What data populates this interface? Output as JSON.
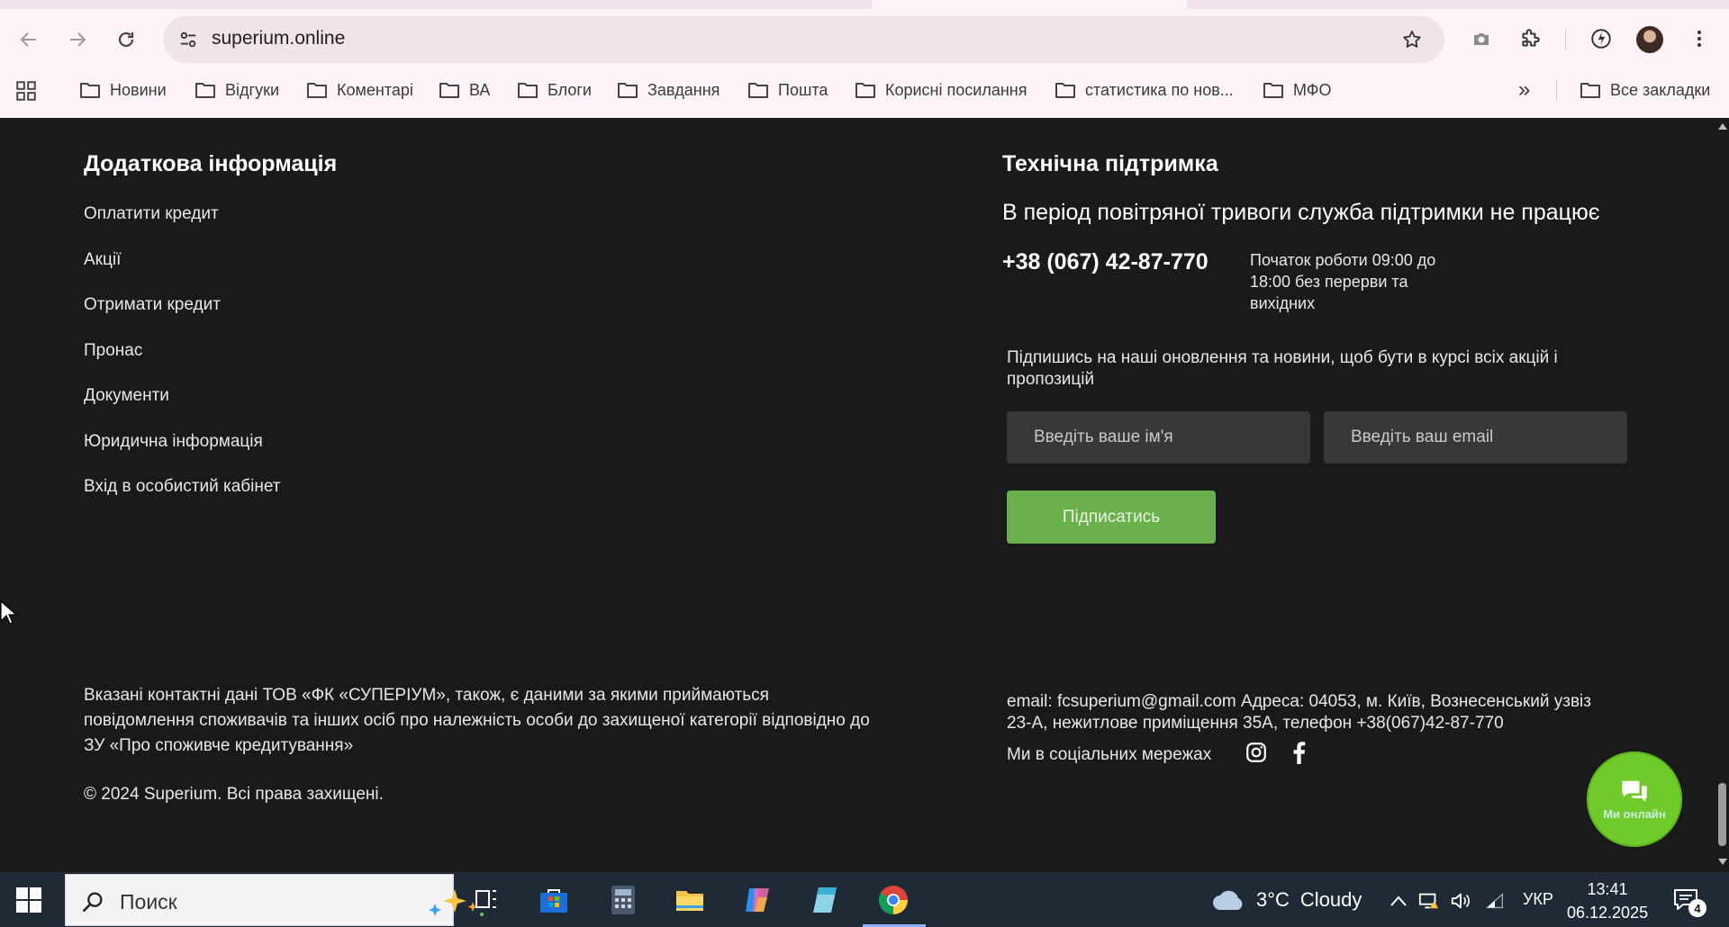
{
  "browser": {
    "url": "superium.online",
    "bookmarks": [
      {
        "label": "Новини"
      },
      {
        "label": "Відгуки"
      },
      {
        "label": "Коментарі"
      },
      {
        "label": "ВА"
      },
      {
        "label": "Блоги"
      },
      {
        "label": "Завдання"
      },
      {
        "label": "Пошта"
      },
      {
        "label": "Корисні посилання"
      },
      {
        "label": "статистика по нов..."
      },
      {
        "label": "МФО"
      }
    ],
    "more_bookmarks": "»",
    "all_bookmarks": "Все закладки"
  },
  "footer": {
    "left_title": "Додаткова інформація",
    "links": [
      "Оплатити кредит",
      "Акції",
      "Отримати кредит",
      "Пронас",
      "Документи",
      "Юридична інформація",
      "Вхід в особистий кабінет"
    ],
    "right_title": "Технічна підтримка",
    "alert": "В період повітряної тривоги служба підтримки не працює",
    "phone": "+38 (067) 42-87-770",
    "hours": "Початок роботи 09:00 до 18:00 без перерви та вихідних",
    "subscribe_text": "Підпишись на наші оновлення та новини, щоб бути в курсі всіх акцій і пропозицій",
    "name_placeholder": "Введіть ваше ім'я",
    "email_placeholder": "Введіть ваш email",
    "subscribe_button": "Підписатись",
    "disclaimer": "Вказані контактні дані ТОВ «ФК «СУПЕРІУМ», також, є даними за якими приймаються повідомлення споживачів та інших осіб про належність особи до захищеної категорії відповідно до ЗУ «Про споживче кредитування»",
    "copyright": "© 2024 Superium. Всі права захищені.",
    "contacts": "email: fcsuperium@gmail.com Адреса: 04053, м. Київ, Вознесенський узвіз 23-А, нежитлове приміщення 35А, телефон +38(067)42-87-770",
    "social_label": "Ми в соціальних мережах",
    "chat_label": "Ми онлайн"
  },
  "taskbar": {
    "search_placeholder": "Поиск",
    "weather_temp": "3°C",
    "weather_desc": "Cloudy",
    "language": "УКР",
    "time": "13:41",
    "date": "06.12.2025",
    "notification_count": "4"
  },
  "colors": {
    "page_bg": "#1a1a1a",
    "accent_green": "#6ab04c",
    "chat_green": "#6fca2a",
    "chrome_bg": "#fdf3f8",
    "taskbar_bg": "#1f2a36"
  }
}
